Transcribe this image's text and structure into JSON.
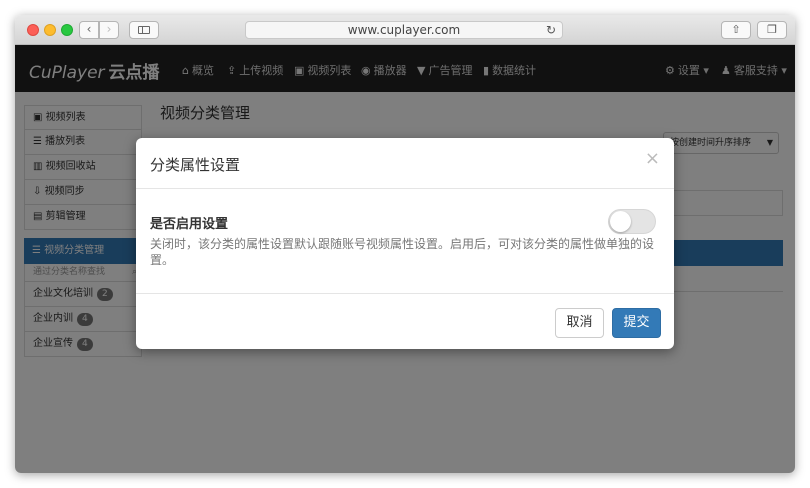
{
  "browser": {
    "url": "www.cuplayer.com",
    "back_glyph": "‹",
    "forward_glyph": "›",
    "reload_glyph": "↻",
    "share_glyph": "⇧",
    "tabs_glyph": "❐"
  },
  "app": {
    "brand": "CuPlayer",
    "brand_cn": "云点播",
    "nav": [
      {
        "icon": "home-icon",
        "glyph": "⌂",
        "label": "概览"
      },
      {
        "icon": "upload-icon",
        "glyph": "⇪",
        "label": "上传视频"
      },
      {
        "icon": "film-icon",
        "glyph": "▣",
        "label": "视频列表"
      },
      {
        "icon": "play-circle-icon",
        "glyph": "◉",
        "label": "播放器"
      },
      {
        "icon": "filter-icon",
        "glyph": "▼",
        "label": "广告管理"
      },
      {
        "icon": "bar-chart-icon",
        "glyph": "▮",
        "label": "数据统计"
      }
    ],
    "right_nav": [
      {
        "icon": "gear-icon",
        "glyph": "⚙",
        "label": "设置 ▾"
      },
      {
        "icon": "bell-icon",
        "glyph": "♟",
        "label": "客服支持 ▾"
      }
    ]
  },
  "sidebar": {
    "items": [
      {
        "glyph": "▣",
        "label": "视频列表"
      },
      {
        "glyph": "☰",
        "label": "播放列表"
      },
      {
        "glyph": "▥",
        "label": "视频回收站"
      },
      {
        "glyph": "⇩",
        "label": "视频同步"
      },
      {
        "glyph": "▤",
        "label": "剪辑管理"
      }
    ],
    "category_header": "☰ 视频分类管理",
    "search_placeholder": "通过分类名称查找",
    "search_glyph": "⌕",
    "categories": [
      {
        "label": "企业文化培训",
        "count": "2"
      },
      {
        "label": "企业内训",
        "count": "4"
      },
      {
        "label": "企业宣传",
        "count": "4"
      }
    ]
  },
  "main": {
    "title": "视频分类管理",
    "sort_select": "按创建时间升序排序",
    "sort_caret": "▼"
  },
  "modal": {
    "title": "分类属性设置",
    "close_glyph": "×",
    "setting_label": "是否启用设置",
    "toggle_on": false,
    "description": "关闭时，该分类的属性设置默认跟随账号视频属性设置。启用后，可对该分类的属性做单独的设置。",
    "cancel_label": "取消",
    "submit_label": "提交"
  }
}
